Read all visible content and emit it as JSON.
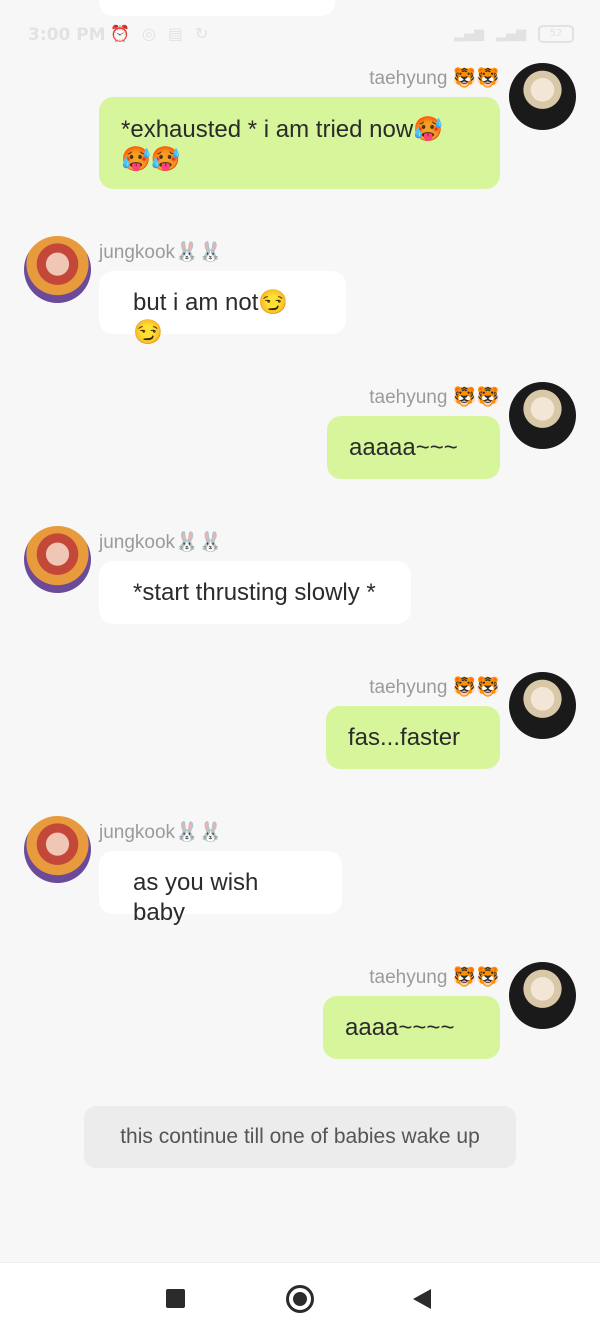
{
  "status_bar": {
    "time": "3:00 PM",
    "icons": [
      "alarm-icon",
      "messenger-icon",
      "msg-icon",
      "sync-icon"
    ],
    "battery": "52"
  },
  "chat": {
    "messages": [
      {
        "sender": "taehyung",
        "name": "taehyung 🐯🐯",
        "text": "*exhausted * i am tried now🥵",
        "text2": "🥵🥵"
      },
      {
        "sender": "jungkook",
        "name": "jungkook🐰🐰",
        "text": "but i am not😏😏"
      },
      {
        "sender": "taehyung",
        "name": "taehyung 🐯🐯",
        "text": "aaaaa~~~"
      },
      {
        "sender": "jungkook",
        "name": "jungkook🐰🐰",
        "text": "*start thrusting slowly *"
      },
      {
        "sender": "taehyung",
        "name": "taehyung 🐯🐯",
        "text": "fas...faster"
      },
      {
        "sender": "jungkook",
        "name": "jungkook🐰🐰",
        "text": "as you wish baby"
      },
      {
        "sender": "taehyung",
        "name": "taehyung 🐯🐯",
        "text": "aaaa~~~~"
      }
    ],
    "narration": "this continue till one of babies  wake up"
  },
  "navbar": {
    "icons": [
      "recents-square-icon",
      "home-circle-icon",
      "back-triangle-icon"
    ]
  }
}
